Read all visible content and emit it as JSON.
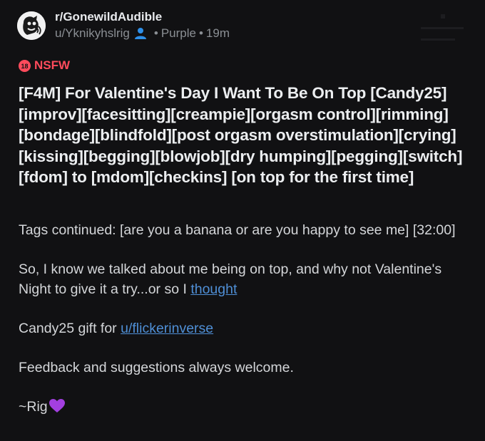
{
  "post": {
    "subreddit": "r/GonewildAudible",
    "author": "u/Yknikyhslrig",
    "separator_1": "•",
    "flair": "Purple",
    "separator_2": "•",
    "age": "19m",
    "nsfw_label": "NSFW",
    "nsfw_badge": "18",
    "title": "[F4M] For Valentine's Day I Want To Be On Top [Candy25] [improv][facesitting][creampie][orgasm control][rimming][bondage][blindfold][post orgasm overstimulation][crying][kissing][begging][blowjob][dry humping][pegging][switch][fdom] to [mdom][checkins] [on top for the first time]",
    "body": {
      "tags_line": "Tags continued: [are you a banana or are you happy to see me] [32:00]",
      "para2_text": "So, I know we talked about me being on top, and why not Valentine's Night to give it a try...or so I ",
      "para2_link": "thought",
      "para3_text": "Candy25 gift for ",
      "para3_link": "u/flickerinverse",
      "para4": "Feedback and suggestions always welcome.",
      "signoff": "~Rig"
    },
    "icons": {
      "avatar": "subreddit-avatar-icon",
      "user": "person-icon",
      "nsfw": "nsfw-18-icon",
      "heart": "purple-heart-emoji"
    },
    "colors": {
      "background": "#111113",
      "nsfw": "#ff4b5c",
      "link": "#4f8fd6",
      "user_icon": "#2e8fe8",
      "heart": "#a33fe0"
    }
  }
}
